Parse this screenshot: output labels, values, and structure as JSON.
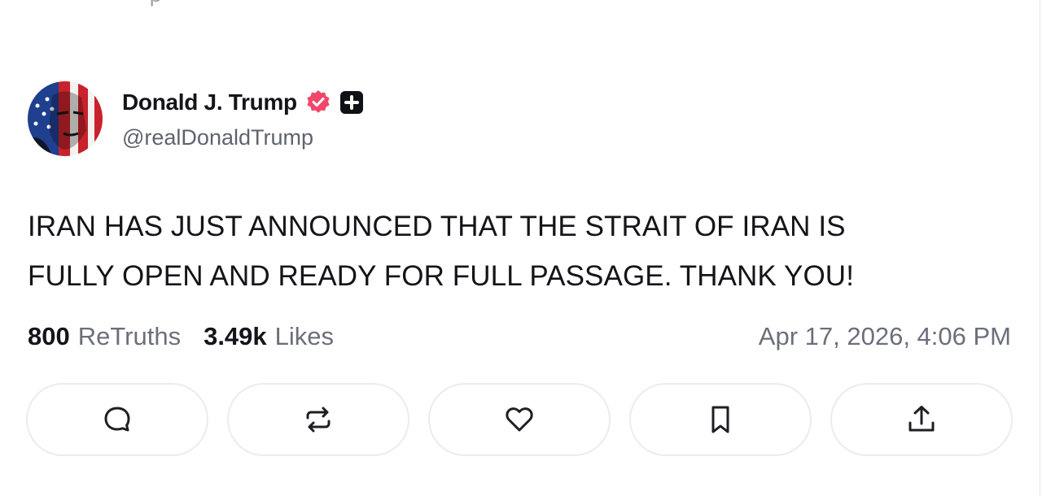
{
  "previous_post_fragment": "· · p · · ·",
  "author": {
    "display_name": "Donald J. Trump",
    "handle": "@realDonaldTrump",
    "verified_color": "#f0476a",
    "avatar_icon": "american-flag-portrait"
  },
  "post": {
    "text_line_1": "IRAN HAS JUST ANNOUNCED THAT THE STRAIT OF IRAN IS",
    "text_line_2": "FULLY OPEN AND READY FOR FULL PASSAGE. THANK YOU!"
  },
  "stats": {
    "retruths_count": "800",
    "retruths_label": "ReTruths",
    "likes_count": "3.49k",
    "likes_label": "Likes",
    "timestamp": "Apr 17, 2026, 4:06 PM"
  },
  "actions": [
    {
      "icon": "reply-icon"
    },
    {
      "icon": "retruth-icon"
    },
    {
      "icon": "like-icon"
    },
    {
      "icon": "bookmark-icon"
    },
    {
      "icon": "share-icon"
    }
  ]
}
